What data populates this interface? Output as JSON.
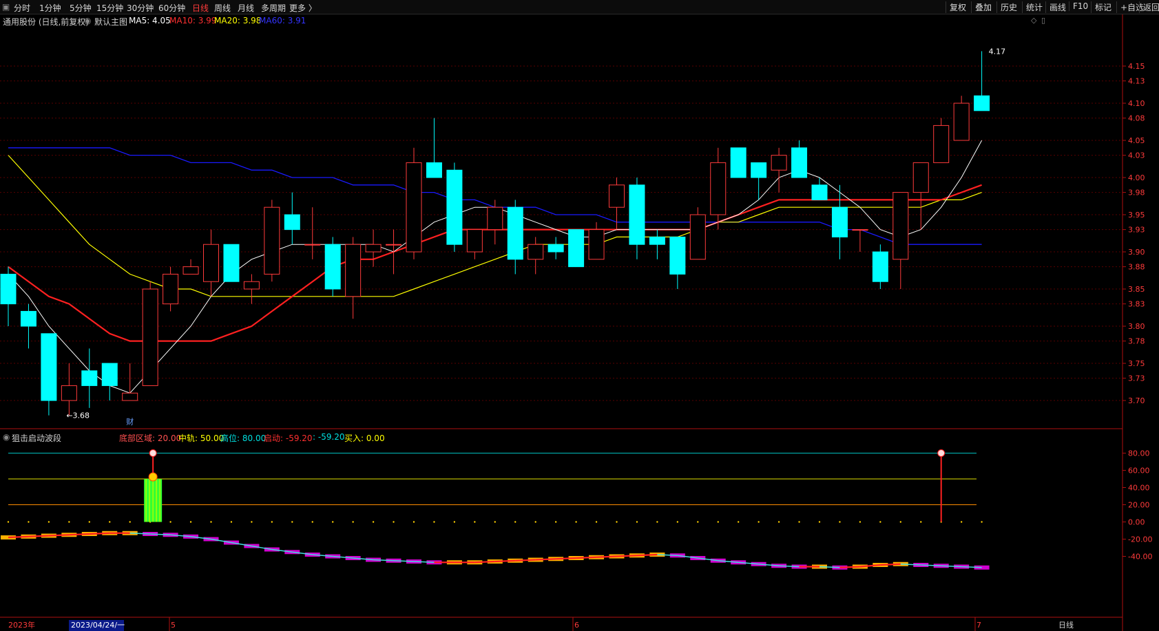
{
  "toolbar": {
    "left": [
      "分时",
      "1分钟",
      "5分钟",
      "15分钟",
      "30分钟",
      "60分钟",
      "日线",
      "周线",
      "月线",
      "多周期",
      "更多 〉"
    ],
    "active": "日线",
    "right": [
      "复权",
      "叠加",
      "历史",
      "统计",
      "画线",
      "F10",
      "标记",
      "+自选",
      "返回"
    ]
  },
  "info": {
    "stock": "通用股份 (日线,前复权)",
    "template": "默认主图",
    "ma5": "MA5: 4.05",
    "ma10": "MA10: 3.99",
    "ma20": "MA20: 3.98",
    "ma60": "MA60: 3.91"
  },
  "indicator": {
    "name": "狙击启动波段",
    "bottom": "底部区域: 20.00",
    "mid": "中轨: 50.00",
    "high": "高位: 80.00",
    "start": "启动: -59.20",
    "blank": ": -59.20",
    "buy": "买入: 0.00"
  },
  "labels": {
    "max": "4.17",
    "min": "←3.68",
    "cai": "财",
    "period": "日线"
  },
  "dates": {
    "year": "2023年",
    "cursor": "2023/04/24/一",
    "m5": "5",
    "m6": "6",
    "m7": "7"
  },
  "colors": {
    "up": "#ff3b3b",
    "down": "#00ffff",
    "ma5": "#ffffff",
    "ma10": "#ff2020",
    "ma20": "#ffff00",
    "ma60": "#1a1aff"
  },
  "chart_data": [
    {
      "type": "candlestick",
      "yticks": [
        "4.15",
        "4.13",
        "4.10",
        "4.08",
        "4.05",
        "4.03",
        "4.00",
        "3.98",
        "3.95",
        "3.93",
        "3.90",
        "3.88",
        "3.85",
        "3.83",
        "3.80",
        "3.78",
        "3.75",
        "3.73",
        "3.70"
      ],
      "ylim": [
        3.663,
        4.2
      ],
      "ohlc": [
        [
          3.87,
          3.88,
          3.8,
          3.83
        ],
        [
          3.82,
          3.83,
          3.77,
          3.8
        ],
        [
          3.79,
          3.79,
          3.68,
          3.7
        ],
        [
          3.7,
          3.75,
          3.68,
          3.72
        ],
        [
          3.74,
          3.77,
          3.69,
          3.72
        ],
        [
          3.75,
          3.75,
          3.7,
          3.72
        ],
        [
          3.7,
          3.75,
          3.7,
          3.71
        ],
        [
          3.72,
          3.86,
          3.72,
          3.85
        ],
        [
          3.83,
          3.88,
          3.82,
          3.87
        ],
        [
          3.87,
          3.89,
          3.87,
          3.88
        ],
        [
          3.86,
          3.93,
          3.84,
          3.91
        ],
        [
          3.91,
          3.91,
          3.86,
          3.86
        ],
        [
          3.85,
          3.87,
          3.83,
          3.86
        ],
        [
          3.87,
          3.97,
          3.86,
          3.96
        ],
        [
          3.95,
          3.98,
          3.91,
          3.93
        ],
        [
          3.91,
          3.96,
          3.89,
          3.91
        ],
        [
          3.91,
          3.92,
          3.84,
          3.85
        ],
        [
          3.84,
          3.92,
          3.81,
          3.91
        ],
        [
          3.9,
          3.93,
          3.88,
          3.91
        ],
        [
          3.91,
          3.93,
          3.87,
          3.91
        ],
        [
          3.9,
          4.04,
          3.89,
          4.02
        ],
        [
          4.02,
          4.08,
          4.01,
          4.0
        ],
        [
          4.01,
          4.02,
          3.9,
          3.91
        ],
        [
          3.9,
          3.93,
          3.89,
          3.93
        ],
        [
          3.93,
          3.97,
          3.91,
          3.96
        ],
        [
          3.96,
          3.97,
          3.87,
          3.89
        ],
        [
          3.89,
          3.92,
          3.87,
          3.91
        ],
        [
          3.91,
          3.92,
          3.89,
          3.9
        ],
        [
          3.93,
          3.93,
          3.88,
          3.88
        ],
        [
          3.89,
          3.94,
          3.89,
          3.93
        ],
        [
          3.96,
          4.0,
          3.93,
          3.99
        ],
        [
          3.99,
          4.0,
          3.89,
          3.91
        ],
        [
          3.92,
          3.93,
          3.89,
          3.91
        ],
        [
          3.92,
          3.92,
          3.85,
          3.87
        ],
        [
          3.89,
          3.96,
          3.89,
          3.95
        ],
        [
          3.95,
          4.04,
          3.93,
          4.02
        ],
        [
          4.04,
          4.04,
          4.0,
          4.0
        ],
        [
          4.02,
          4.02,
          3.97,
          4.0
        ],
        [
          4.01,
          4.04,
          3.98,
          4.03
        ],
        [
          4.04,
          4.05,
          4.0,
          4.0
        ],
        [
          3.99,
          4.0,
          3.97,
          3.97
        ],
        [
          3.96,
          3.99,
          3.89,
          3.92
        ],
        [
          3.93,
          3.93,
          3.9,
          3.93
        ],
        [
          3.9,
          3.91,
          3.85,
          3.86
        ],
        [
          3.89,
          3.98,
          3.85,
          3.98
        ],
        [
          3.98,
          4.02,
          3.93,
          4.02
        ],
        [
          4.02,
          4.08,
          4.02,
          4.07
        ],
        [
          4.05,
          4.11,
          4.05,
          4.1
        ],
        [
          4.11,
          4.17,
          4.09,
          4.09
        ]
      ],
      "ma5": [
        3.87,
        3.84,
        3.8,
        3.77,
        3.74,
        3.72,
        3.71,
        3.74,
        3.77,
        3.8,
        3.84,
        3.87,
        3.89,
        3.9,
        3.91,
        3.91,
        3.91,
        3.91,
        3.91,
        3.9,
        3.92,
        3.94,
        3.95,
        3.96,
        3.96,
        3.95,
        3.94,
        3.93,
        3.92,
        3.92,
        3.93,
        3.93,
        3.93,
        3.93,
        3.93,
        3.94,
        3.95,
        3.97,
        4.0,
        4.01,
        4.0,
        3.98,
        3.96,
        3.93,
        3.92,
        3.93,
        3.96,
        4.0,
        4.05
      ],
      "ma10": [
        3.88,
        3.86,
        3.84,
        3.83,
        3.81,
        3.79,
        3.78,
        3.78,
        3.78,
        3.78,
        3.78,
        3.79,
        3.8,
        3.82,
        3.84,
        3.86,
        3.88,
        3.89,
        3.89,
        3.9,
        3.91,
        3.92,
        3.93,
        3.93,
        3.93,
        3.93,
        3.93,
        3.93,
        3.93,
        3.93,
        3.93,
        3.93,
        3.93,
        3.93,
        3.93,
        3.94,
        3.95,
        3.96,
        3.97,
        3.97,
        3.97,
        3.97,
        3.97,
        3.97,
        3.97,
        3.97,
        3.97,
        3.98,
        3.99
      ],
      "ma20": [
        4.03,
        4.0,
        3.97,
        3.94,
        3.91,
        3.89,
        3.87,
        3.86,
        3.85,
        3.85,
        3.84,
        3.84,
        3.84,
        3.84,
        3.84,
        3.84,
        3.84,
        3.84,
        3.84,
        3.84,
        3.85,
        3.86,
        3.87,
        3.88,
        3.89,
        3.9,
        3.91,
        3.91,
        3.91,
        3.91,
        3.92,
        3.92,
        3.92,
        3.92,
        3.93,
        3.94,
        3.94,
        3.95,
        3.96,
        3.96,
        3.96,
        3.96,
        3.96,
        3.96,
        3.96,
        3.96,
        3.97,
        3.97,
        3.98
      ],
      "ma60": [
        4.04,
        4.04,
        4.04,
        4.04,
        4.04,
        4.04,
        4.03,
        4.03,
        4.03,
        4.02,
        4.02,
        4.02,
        4.01,
        4.01,
        4.0,
        4.0,
        4.0,
        3.99,
        3.99,
        3.99,
        3.98,
        3.98,
        3.97,
        3.97,
        3.96,
        3.96,
        3.96,
        3.95,
        3.95,
        3.95,
        3.94,
        3.94,
        3.94,
        3.94,
        3.94,
        3.94,
        3.94,
        3.94,
        3.94,
        3.94,
        3.94,
        3.93,
        3.93,
        3.92,
        3.91,
        3.91,
        3.91,
        3.91,
        3.91
      ]
    },
    {
      "type": "indicator",
      "yticks": [
        "80.00",
        "60.00",
        "40.00",
        "20.00",
        "0.00",
        "-20.00",
        "-40.00"
      ],
      "ylim": [
        -70,
        90
      ],
      "levels": [
        20,
        50,
        80
      ],
      "curve": [
        -18,
        -17,
        -16,
        -15,
        -14,
        -13,
        -13,
        -14,
        -15,
        -17,
        -20,
        -24,
        -28,
        -32,
        -35,
        -38,
        -40,
        -42,
        -44,
        -45,
        -46,
        -47,
        -47,
        -47,
        -46,
        -45,
        -44,
        -43,
        -42,
        -41,
        -40,
        -39,
        -38,
        -39,
        -42,
        -45,
        -47,
        -49,
        -51,
        -52,
        -52,
        -53,
        -52,
        -50,
        -49,
        -50,
        -51,
        -52,
        -53
      ],
      "buy_signal_x": 7,
      "high_signal_x": 46
    }
  ]
}
